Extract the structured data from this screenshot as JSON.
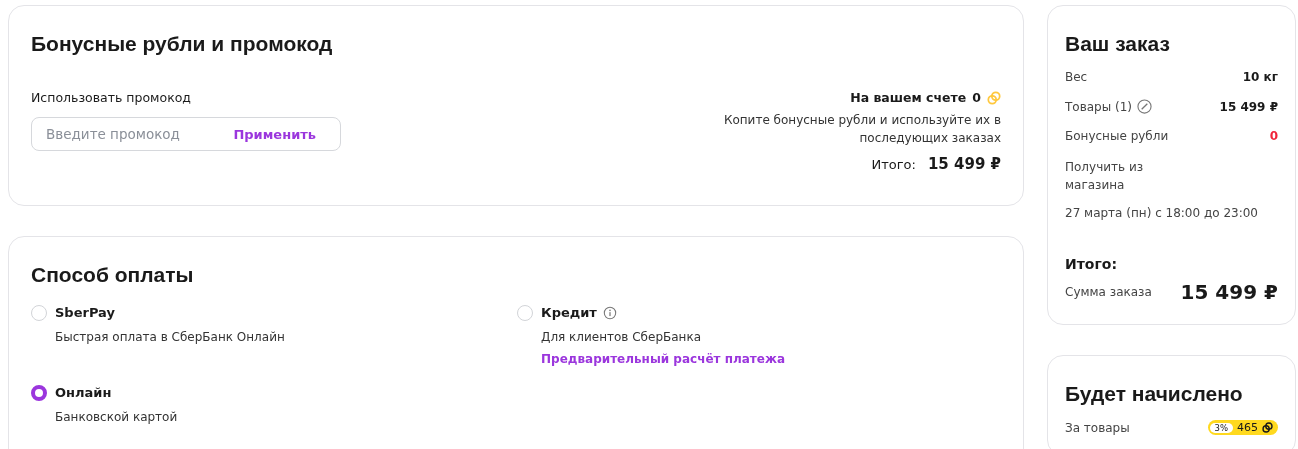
{
  "promo_card": {
    "title": "Бонусные рубли и промокод",
    "promo_label": "Использовать промокод",
    "promo_field": {
      "placeholder": "Введите промокод"
    },
    "apply_button": "Применить",
    "balance_label": "На вашем счете",
    "balance_value": "0",
    "hint": "Копите бонусные рубли и используйте их в последующих заказах",
    "total_label": "Итого:",
    "total_value": "15 499 ₽"
  },
  "payment_card": {
    "title": "Способ оплаты",
    "options": [
      {
        "name": "SberPay",
        "description": "Быстрая оплата в СберБанк Онлайн",
        "selected": false,
        "info": false
      },
      {
        "name": "Кредит",
        "description": "Для клиентов СберБанка",
        "selected": false,
        "info": true,
        "link": "Предварительный расчёт платежа"
      },
      {
        "name": "Онлайн",
        "description": "Банковской картой",
        "selected": true,
        "info": false
      }
    ]
  },
  "order_card": {
    "title": "Ваш заказ",
    "rows": [
      {
        "label": "Вес",
        "value": "10 кг",
        "edit": false,
        "color": "#1a1a1a"
      },
      {
        "label": "Товары (1)",
        "value": "15 499 ₽",
        "edit": true,
        "color": "#1a1a1a"
      },
      {
        "label": "Бонусные рубли",
        "value": "0",
        "edit": false,
        "color": "#f0263b"
      },
      {
        "label": "Получить из магазина",
        "edit": false
      }
    ],
    "delivery_time": "27 марта (пн)  с 18:00 до 23:00",
    "total_title": "Итого:",
    "sum_label": "Сумма заказа",
    "sum_value": "15 499 ₽"
  },
  "bonus_card": {
    "title": "Будет начислено",
    "rows": [
      {
        "label": "За товары",
        "percent": "3%",
        "amount": "465"
      }
    ]
  }
}
